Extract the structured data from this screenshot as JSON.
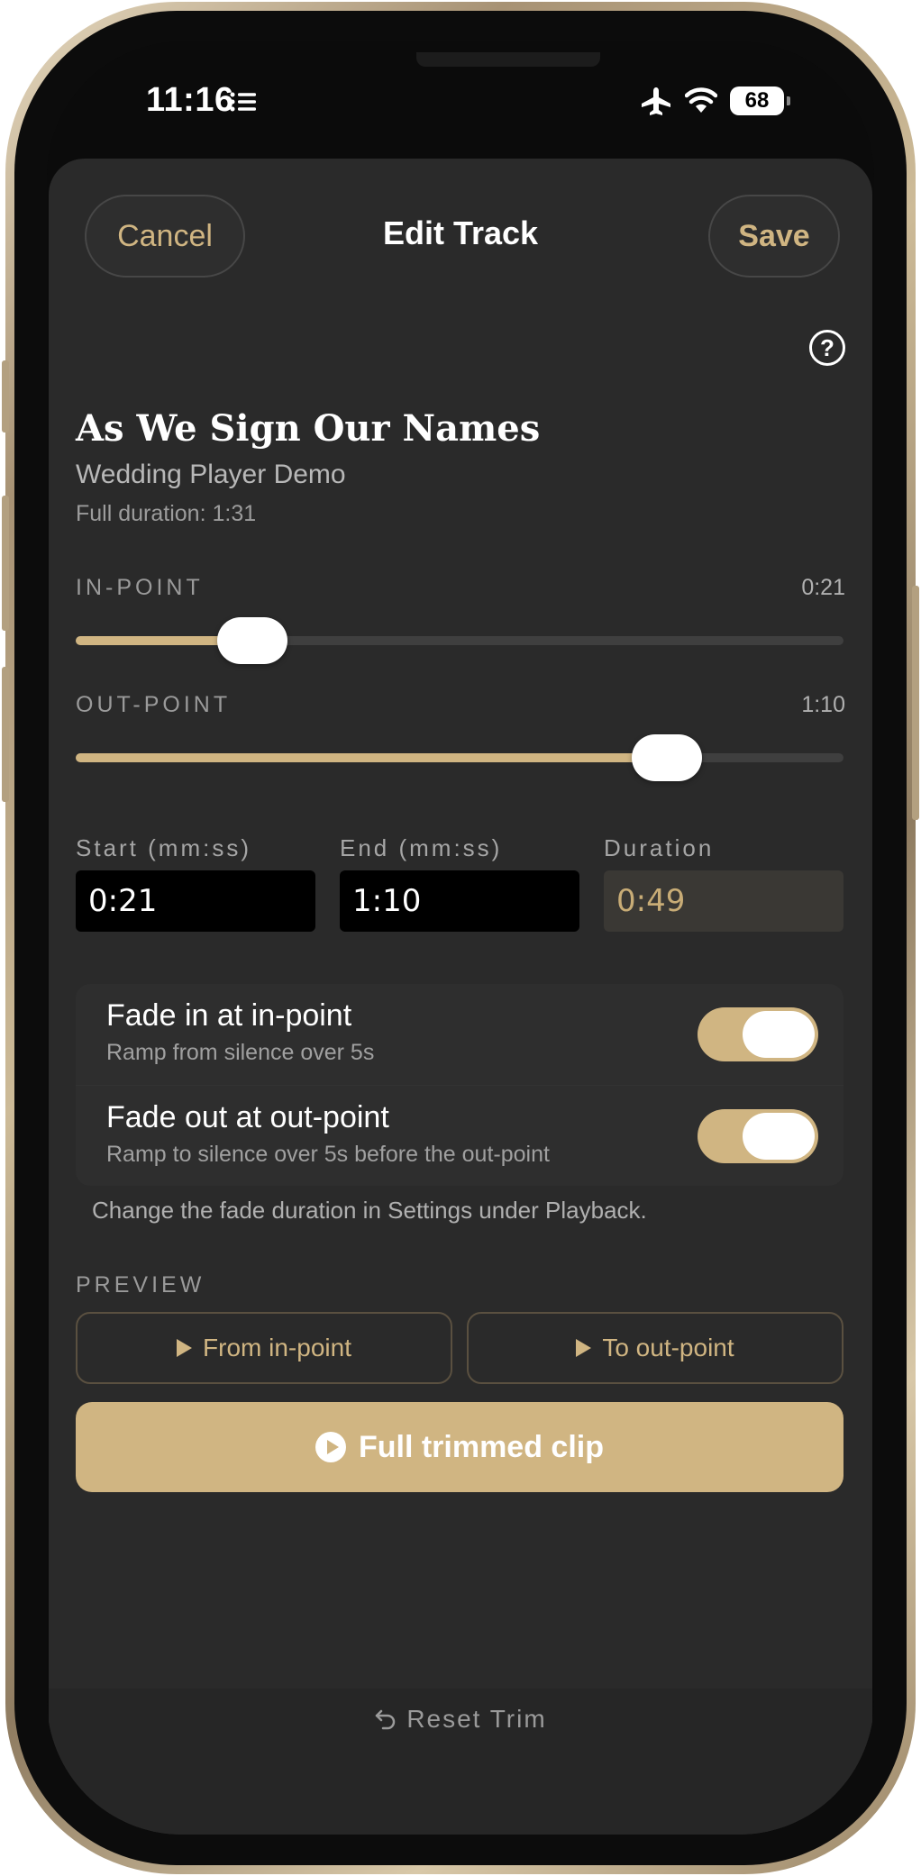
{
  "status_bar": {
    "time": "11:16",
    "battery": "68"
  },
  "nav": {
    "cancel_label": "Cancel",
    "title": "Edit Track",
    "save_label": "Save"
  },
  "help": {
    "label": "?"
  },
  "track": {
    "title": "As We Sign Our Names",
    "artist": "Wedding Player Demo",
    "full_duration": "Full duration: 1:31"
  },
  "in_point": {
    "label": "IN-POINT",
    "value": "0:21",
    "fraction": 0.23
  },
  "out_point": {
    "label": "OUT-POINT",
    "value": "1:10",
    "fraction": 0.77
  },
  "fields": {
    "start_label": "Start (mm:ss)",
    "start_value": "0:21",
    "end_label": "End (mm:ss)",
    "end_value": "1:10",
    "duration_label": "Duration",
    "duration_value": "0:49"
  },
  "fade_in": {
    "title": "Fade in at in-point",
    "subtitle": "Ramp from silence over 5s",
    "on": true
  },
  "fade_out": {
    "title": "Fade out at out-point",
    "subtitle": "Ramp to silence over 5s before the out-point",
    "on": true
  },
  "footnote": "Change the fade duration in Settings under Playback.",
  "preview": {
    "label": "PREVIEW",
    "from_in_label": "From in-point",
    "to_out_label": "To out-point",
    "full_label": "Full trimmed clip"
  },
  "reset_label": "Reset Trim",
  "colors": {
    "accent": "#d0b582",
    "sheet": "#2a2a2a",
    "background": "#0b0b0b"
  }
}
